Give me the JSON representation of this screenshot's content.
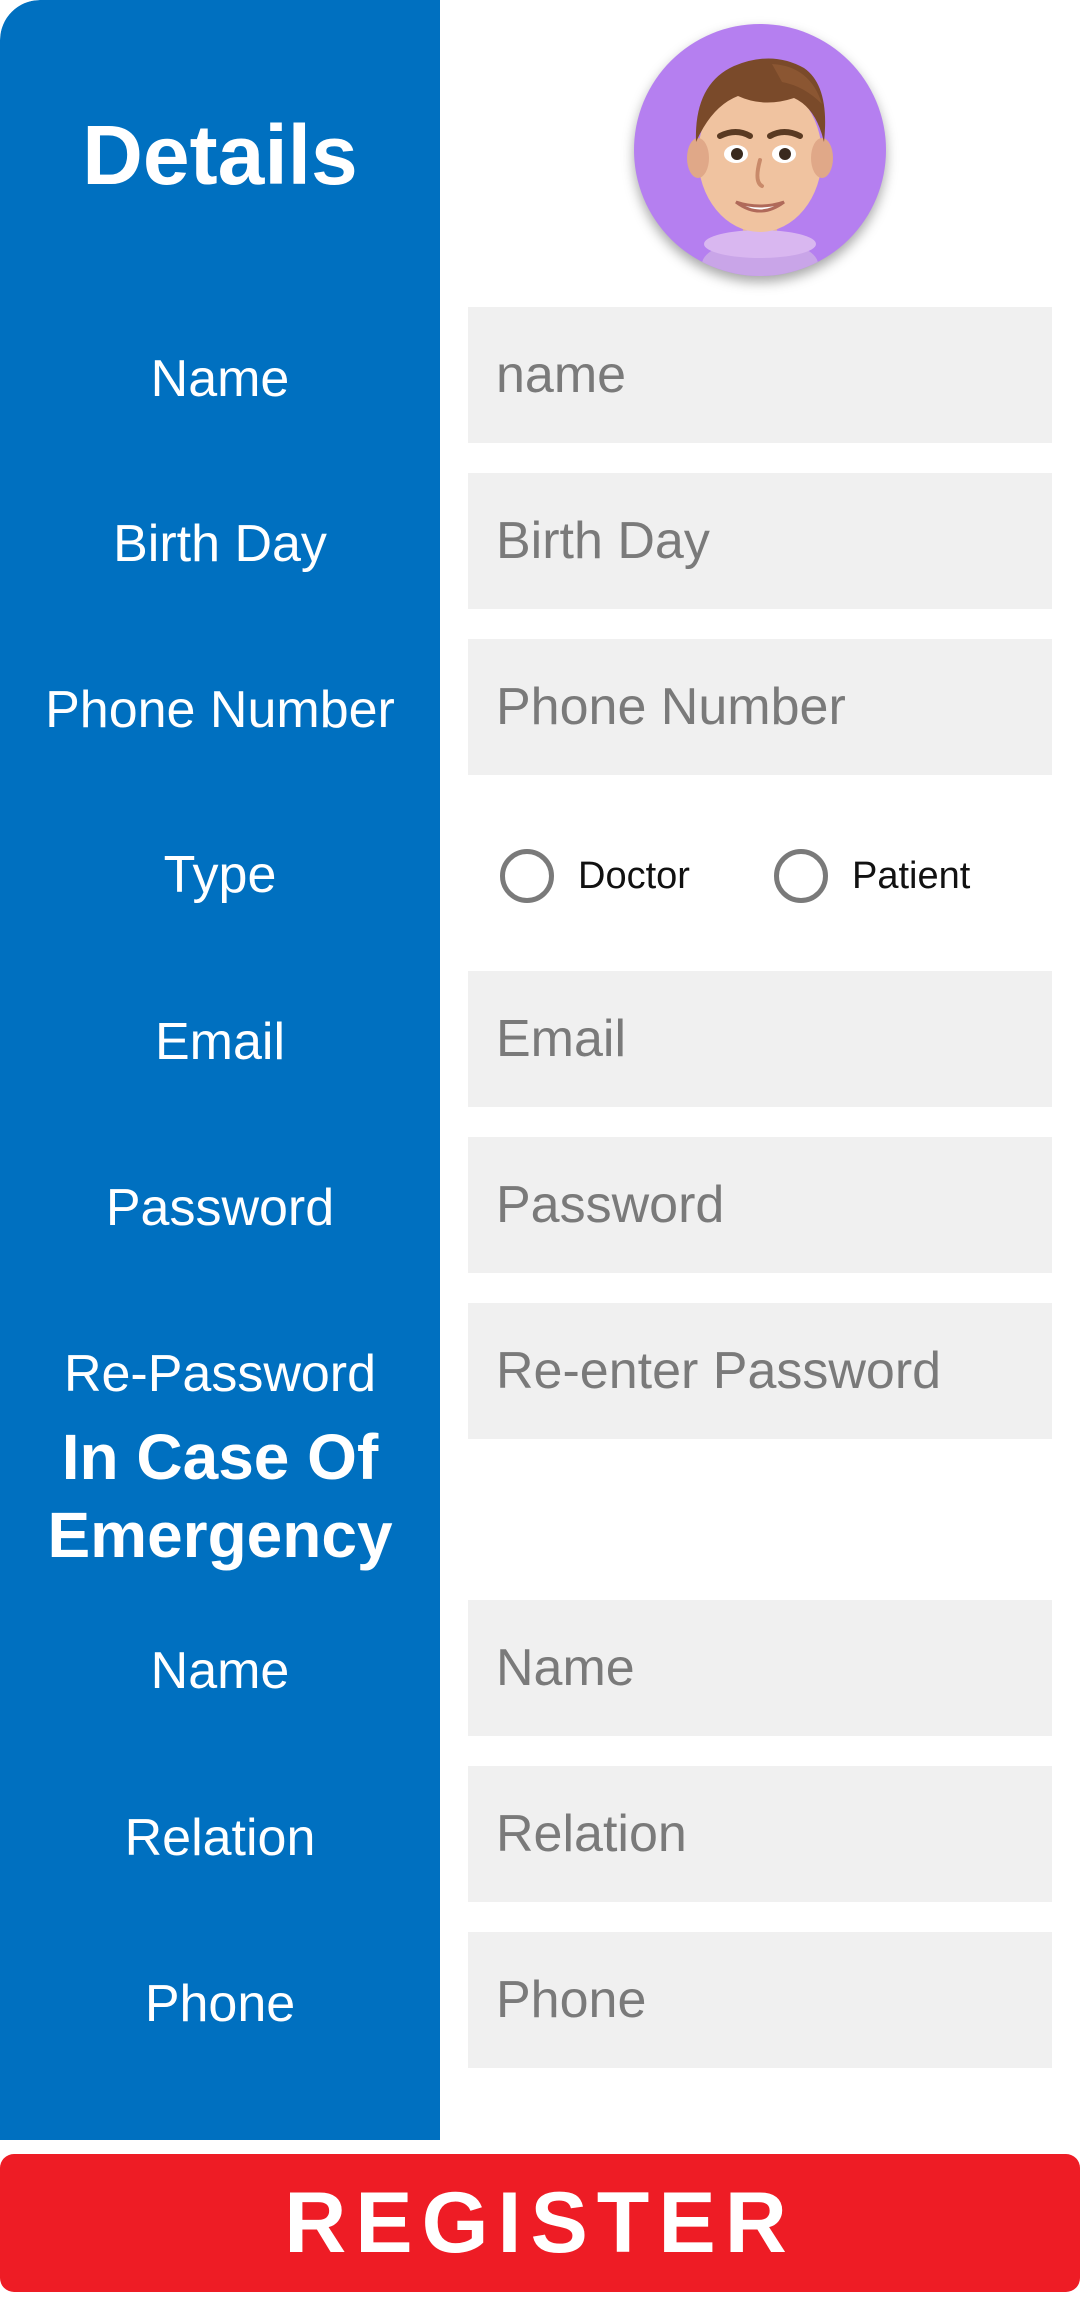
{
  "header": {
    "title": "Details",
    "avatar_icon": "male-avatar-icon"
  },
  "colors": {
    "panel": "#0070c0",
    "field_bg": "#f0f0f0",
    "register": "#ee1c25",
    "avatar_bg": "#b57ff0"
  },
  "fields": {
    "name": {
      "label": "Name",
      "placeholder": "name",
      "value": ""
    },
    "birthday": {
      "label": "Birth Day",
      "placeholder": "Birth Day",
      "value": ""
    },
    "phone": {
      "label": "Phone Number",
      "placeholder": "Phone Number",
      "value": ""
    },
    "type": {
      "label": "Type",
      "options": [
        "Doctor",
        "Patient"
      ],
      "selected": null
    },
    "email": {
      "label": "Email",
      "placeholder": "Email",
      "value": ""
    },
    "password": {
      "label": "Password",
      "placeholder": "Password",
      "value": ""
    },
    "repassword": {
      "label": "Re-Password",
      "placeholder": "Re-enter Password",
      "value": ""
    }
  },
  "emergency": {
    "title_line1": "In Case Of",
    "title_line2": "Emergency",
    "name": {
      "label": "Name",
      "placeholder": "Name",
      "value": ""
    },
    "relation": {
      "label": "Relation",
      "placeholder": "Relation",
      "value": ""
    },
    "phone": {
      "label": "Phone",
      "placeholder": "Phone",
      "value": ""
    }
  },
  "actions": {
    "register_label": "REGISTER"
  }
}
